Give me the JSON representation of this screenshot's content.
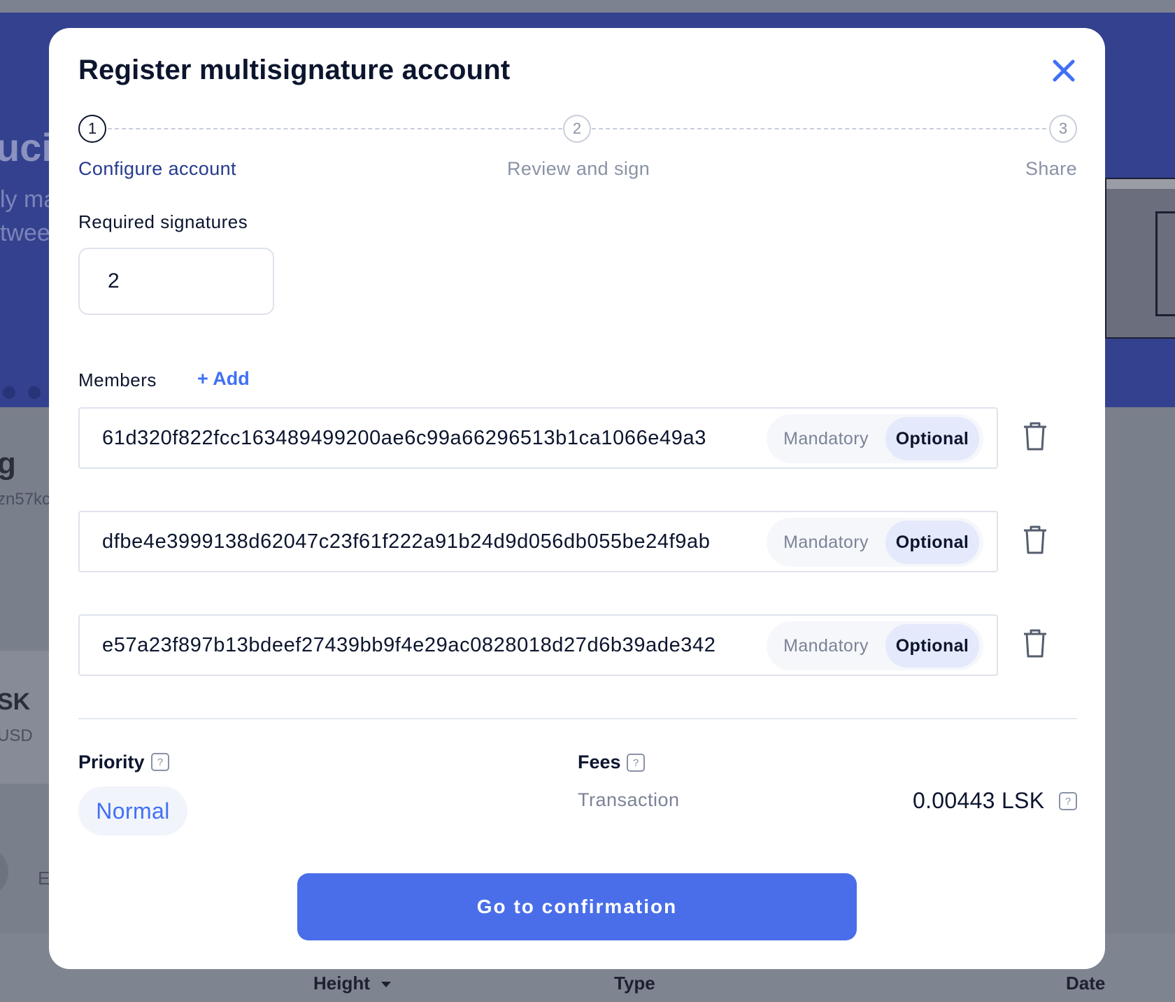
{
  "background": {
    "hero_title_fragment": "ucir",
    "hero_line1_fragment": "ly ma",
    "hero_line2_fragment": "twee",
    "account_name_fragment": "g",
    "account_address_fragment": "zn57kc",
    "balance_fragment": "SK",
    "balance_usd_fragment": "USD",
    "tab_fragment": "E",
    "table_columns": {
      "height": "Height",
      "type": "Type",
      "date": "Date"
    }
  },
  "modal": {
    "title": "Register multisignature account",
    "steps": [
      {
        "number": "1",
        "label": "Configure account"
      },
      {
        "number": "2",
        "label": "Review and sign"
      },
      {
        "number": "3",
        "label": "Share"
      }
    ],
    "required_signatures": {
      "label": "Required signatures",
      "value": "2"
    },
    "members": {
      "label": "Members",
      "add_label": "+ Add",
      "items": [
        {
          "key": "61d320f822fcc163489499200ae6c99a66296513b1ca1066e49a3",
          "mandatory_label": "Mandatory",
          "optional_label": "Optional"
        },
        {
          "key": "dfbe4e3999138d62047c23f61f222a91b24d9d056db055be24f9ab",
          "mandatory_label": "Mandatory",
          "optional_label": "Optional"
        },
        {
          "key": "e57a23f897b13bdeef27439bb9f4e29ac0828018d27d6b39ade342",
          "mandatory_label": "Mandatory",
          "optional_label": "Optional"
        }
      ]
    },
    "priority": {
      "label": "Priority",
      "help": "?",
      "value": "Normal"
    },
    "fees": {
      "label": "Fees",
      "help": "?",
      "transaction_label": "Transaction",
      "transaction_value": "0.00443 LSK",
      "value_help": "?"
    },
    "confirm_button": "Go to confirmation"
  },
  "colors": {
    "accent": "#4a6ee9",
    "link": "#4070f4",
    "text_dark": "#0c152e",
    "step_active": "#263b8e"
  },
  "icons": {
    "close": "close-icon",
    "delete": "trash-icon",
    "help": "help-icon",
    "sort": "caret-down-icon"
  }
}
